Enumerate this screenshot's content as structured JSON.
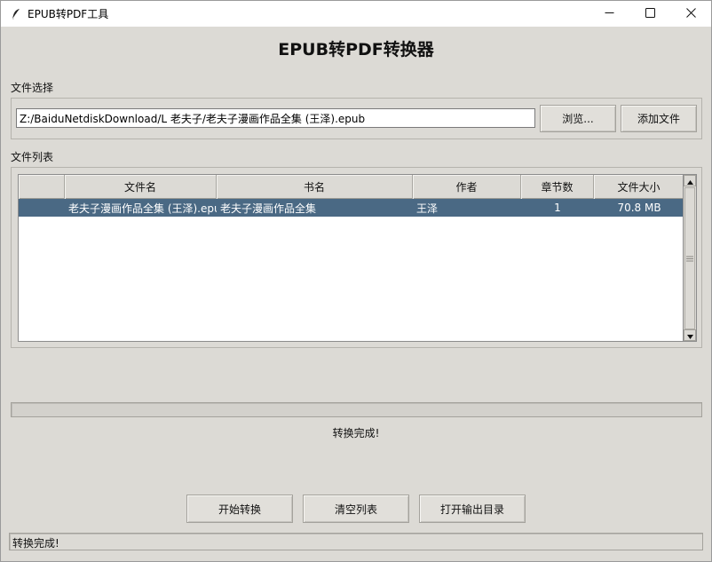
{
  "window": {
    "title": "EPUB转PDF工具",
    "controls": {
      "minimize": "minimize-icon",
      "maximize": "maximize-icon",
      "close": "close-icon"
    }
  },
  "heading": "EPUB转PDF转换器",
  "file_select": {
    "label": "文件选择",
    "path_value": "Z:/BaiduNetdiskDownload/L 老夫子/老夫子漫画作品全集 (王泽).epub",
    "browse_label": "浏览...",
    "add_label": "添加文件"
  },
  "file_list": {
    "label": "文件列表",
    "columns": [
      "",
      "文件名",
      "书名",
      "作者",
      "章节数",
      "文件大小"
    ],
    "rows": [
      {
        "index": "",
        "filename": "老夫子漫画作品全集 (王泽).epub",
        "title": "老夫子漫画作品全集",
        "author": "王泽",
        "chapters": "1",
        "size": "70.8 MB"
      }
    ]
  },
  "progress": {
    "value": 0
  },
  "status_message": "转换完成!",
  "actions": {
    "start_label": "开始转换",
    "clear_label": "清空列表",
    "open_output_label": "打开输出目录"
  },
  "statusbar": {
    "text": "转换完成!"
  },
  "colors": {
    "window_bg": "#dcdad5",
    "selection": "#4a6984",
    "titlebar": "#ffffff"
  }
}
